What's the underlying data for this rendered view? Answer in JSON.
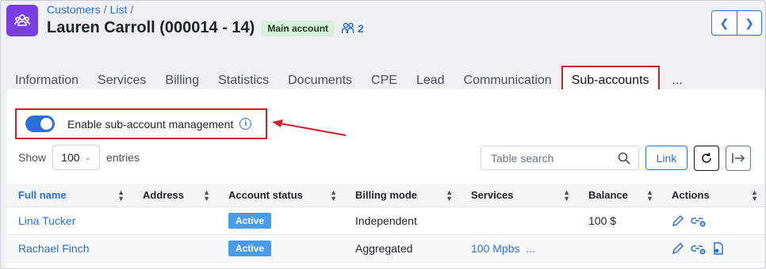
{
  "header": {
    "breadcrumb": [
      "Customers",
      "List"
    ],
    "title": "Lauren Carroll (000014 - 14)",
    "badge": "Main account",
    "subaccount_count": "2"
  },
  "tabs": [
    "Information",
    "Services",
    "Billing",
    "Statistics",
    "Documents",
    "CPE",
    "Lead",
    "Communication",
    "Sub-accounts"
  ],
  "tabs_more": "...",
  "toggle": {
    "label": "Enable sub-account management",
    "enabled": true
  },
  "length": {
    "show": "Show",
    "value": "100",
    "entries": "entries"
  },
  "search": {
    "placeholder": "Table search"
  },
  "buttons": {
    "link": "Link"
  },
  "table": {
    "columns": [
      "Full name",
      "Address",
      "Account status",
      "Billing mode",
      "Services",
      "Balance",
      "Actions"
    ],
    "rows": [
      {
        "name": "Lina Tucker",
        "address": "",
        "status": "Active",
        "billing": "Independent",
        "services": "",
        "services_more": "",
        "balance": "100 $"
      },
      {
        "name": "Rachael Finch",
        "address": "",
        "status": "Active",
        "billing": "Aggregated",
        "services": "100 Mpbs",
        "services_more": "...",
        "balance": ""
      }
    ]
  },
  "colors": {
    "accent": "#2a6fdb",
    "highlight": "#cf1f28",
    "app_icon": "#7a3fe4",
    "status": "#4a9be8"
  }
}
